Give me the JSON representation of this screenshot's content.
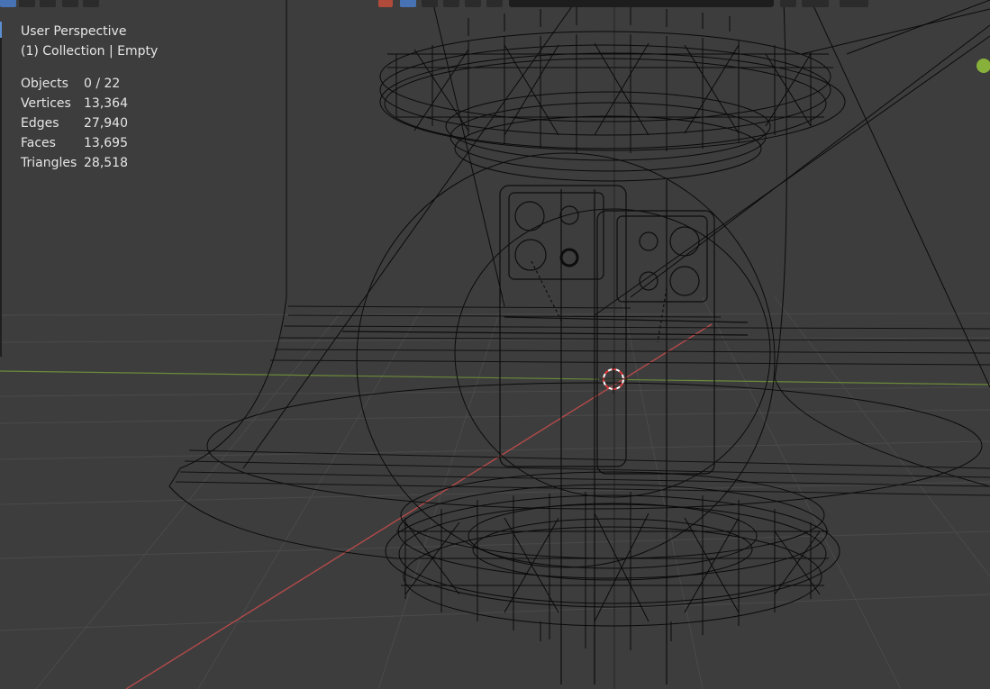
{
  "viewport": {
    "view_name": "User Perspective",
    "collection_line": "(1) Collection | Empty",
    "stats": [
      {
        "label": "Objects",
        "value": "0 / 22"
      },
      {
        "label": "Vertices",
        "value": "13,364"
      },
      {
        "label": "Edges",
        "value": "27,940"
      },
      {
        "label": "Faces",
        "value": "13,695"
      },
      {
        "label": "Triangles",
        "value": "28,518"
      }
    ]
  },
  "colors": {
    "background": "#3d3d3d",
    "x_axis": "#b54a4a",
    "y_axis": "#6b8a3a",
    "wire": "#0a0a0a",
    "cursor_red": "#e33b3b",
    "gizmo_y": "#87b13a"
  },
  "icons": [
    "select-box-icon",
    "select-toggle-icon",
    "viewport-shading-icon",
    "search-icon",
    "overlay-icon",
    "3d-cursor-icon"
  ]
}
